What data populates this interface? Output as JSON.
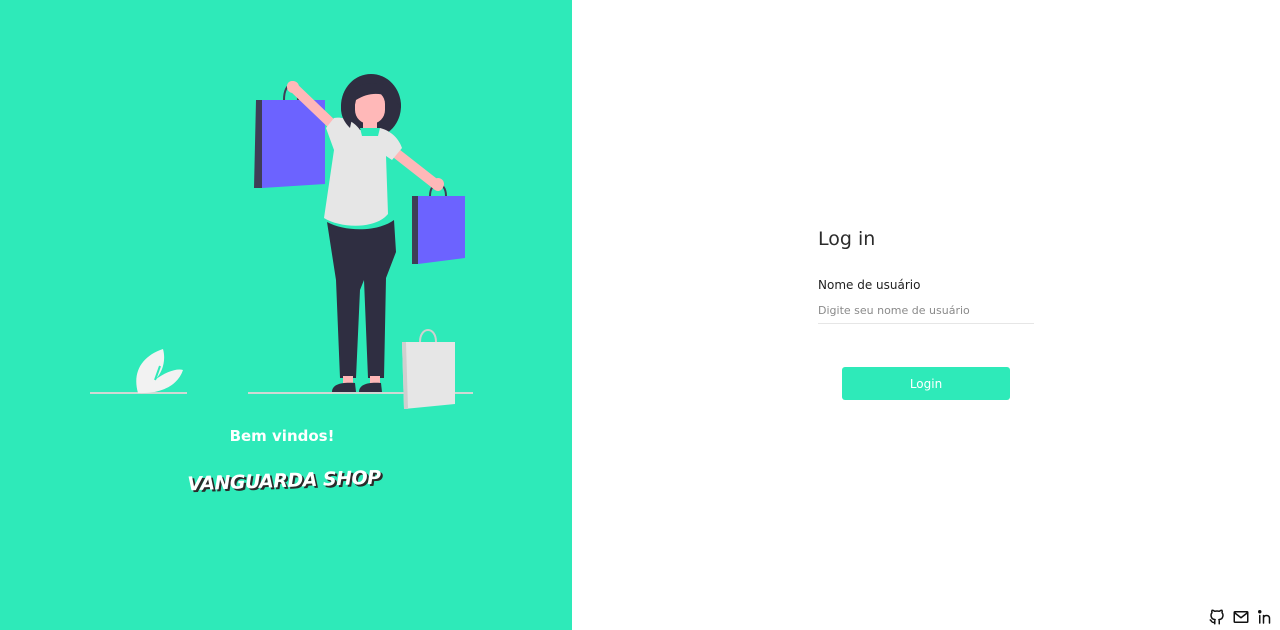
{
  "hero": {
    "welcome": "Bem vindos!",
    "brand": "VANGUARDA SHOP",
    "colors": {
      "background": "#2eeab9",
      "bag": "#6c63ff",
      "hair": "#2f2e41",
      "skin": "#ffb8b8"
    }
  },
  "login": {
    "title": "Log in",
    "username_label": "Nome de usuário",
    "username_placeholder": "Digite seu nome de usuário",
    "username_value": "",
    "submit_label": "Login",
    "accent": "#2eeab9"
  },
  "footer": {
    "icons": [
      "github-icon",
      "mail-icon",
      "linkedin-icon"
    ]
  }
}
